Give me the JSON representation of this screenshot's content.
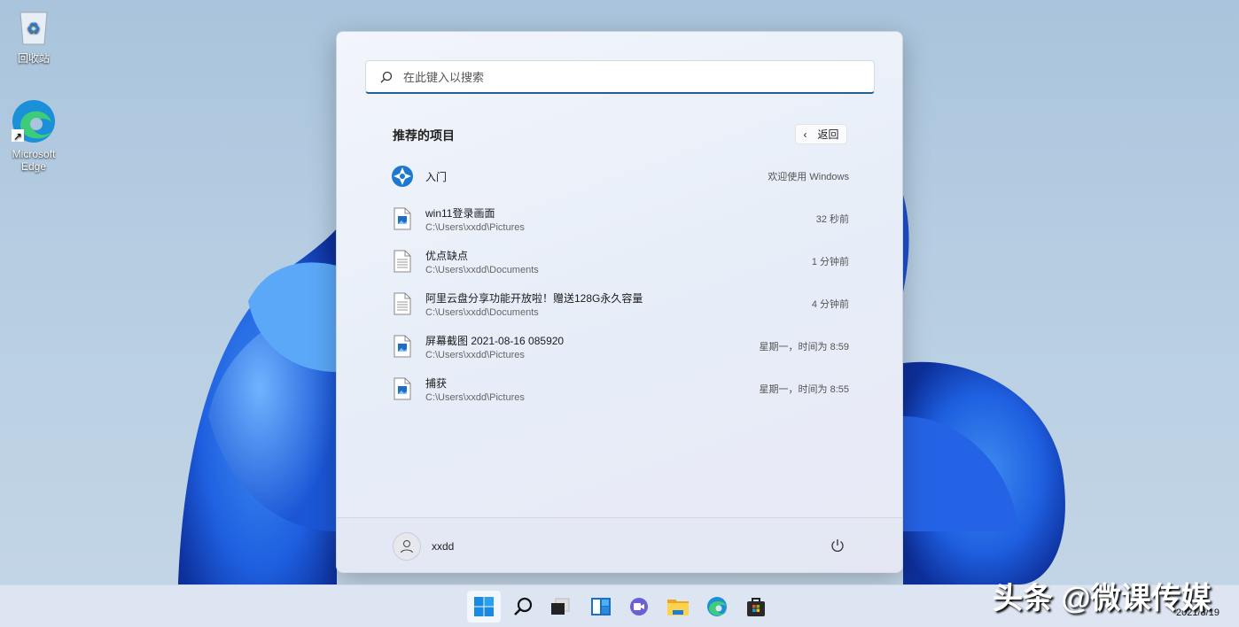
{
  "desktop": {
    "icons": [
      {
        "label": "回收站"
      },
      {
        "label": "Microsoft Edge"
      }
    ]
  },
  "start": {
    "search_placeholder": "在此键入以搜索",
    "section_title": "推荐的项目",
    "back_label": "返回",
    "items": [
      {
        "name": "入门",
        "path": "",
        "time": "欢迎使用 Windows",
        "icon": "get-started-icon"
      },
      {
        "name": "win11登录画面",
        "path": "C:\\Users\\xxdd\\Pictures",
        "time": "32 秒前",
        "icon": "image-file-icon"
      },
      {
        "name": "优点缺点",
        "path": "C:\\Users\\xxdd\\Documents",
        "time": "1 分钟前",
        "icon": "text-file-icon"
      },
      {
        "name": "阿里云盘分享功能开放啦！赠送128G永久容量",
        "path": "C:\\Users\\xxdd\\Documents",
        "time": "4 分钟前",
        "icon": "text-file-icon"
      },
      {
        "name": "屏幕截图 2021-08-16 085920",
        "path": "C:\\Users\\xxdd\\Pictures",
        "time": "星期一，时间为 8:59",
        "icon": "image-file-icon"
      },
      {
        "name": "捕获",
        "path": "C:\\Users\\xxdd\\Pictures",
        "time": "星期一，时间为 8:55",
        "icon": "image-file-icon"
      }
    ],
    "user": "xxdd"
  },
  "taskbar": {
    "apps": [
      "start",
      "search",
      "task-view",
      "widgets",
      "teams-chat",
      "file-explorer",
      "edge",
      "store"
    ],
    "date": "2021/8/19"
  },
  "watermark": "头条 @微课传媒"
}
